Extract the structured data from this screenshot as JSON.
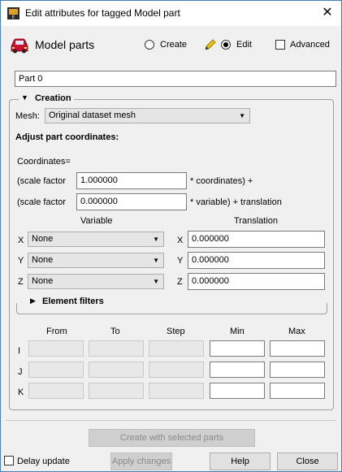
{
  "window": {
    "title": "Edit attributes for tagged Model part",
    "close_glyph": "✕"
  },
  "header": {
    "title": "Model parts",
    "create_label": "Create",
    "edit_label": "Edit",
    "advanced_label": "Advanced",
    "mode_selected": "Edit"
  },
  "part_name": "Part 0",
  "creation": {
    "section_label": "Creation",
    "mesh_label": "Mesh:",
    "mesh_value": "Original dataset mesh",
    "adjust_heading": "Adjust part coordinates:",
    "coordinates_label": "Coordinates=",
    "scale1_prefix": "(scale factor",
    "scale1_value": "1.000000",
    "scale1_suffix": "* coordinates) +",
    "scale2_prefix": "(scale factor",
    "scale2_value": "0.000000",
    "scale2_suffix": "* variable) + translation",
    "variable_header": "Variable",
    "translation_header": "Translation",
    "rows": [
      {
        "axis": "X",
        "variable": "None",
        "translation_axis": "X",
        "translation": "0.000000"
      },
      {
        "axis": "Y",
        "variable": "None",
        "translation_axis": "Y",
        "translation": "0.000000"
      },
      {
        "axis": "Z",
        "variable": "None",
        "translation_axis": "Z",
        "translation": "0.000000"
      }
    ],
    "element_filters_label": "Element filters",
    "ijk_headers": [
      "From",
      "To",
      "Step",
      "Min",
      "Max"
    ],
    "ijk_rows": [
      "I",
      "J",
      "K"
    ]
  },
  "buttons": {
    "create_with_selected": "Create with selected parts",
    "delay_update": "Delay update",
    "apply_changes": "Apply changes",
    "help": "Help",
    "close": "Close"
  },
  "colors": {
    "window_border": "#4a7fb5",
    "dialog_bg": "#f0f0f0",
    "car_icon": "#c8102e"
  }
}
